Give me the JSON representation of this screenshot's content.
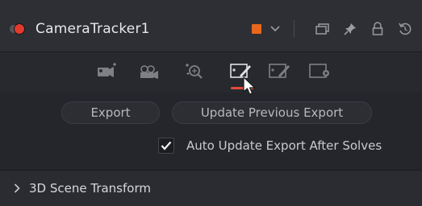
{
  "node": {
    "title": "CameraTracker1",
    "color": "#e8671d",
    "status_color": "#e23a2e"
  },
  "title_icons": [
    "chevron-down-icon",
    "version-icon",
    "pin-icon",
    "lock-icon",
    "reset-icon"
  ],
  "toolbar": {
    "tools": [
      {
        "name": "track-icon"
      },
      {
        "name": "camera-icon"
      },
      {
        "name": "solve-icon"
      },
      {
        "name": "export-icon",
        "active": true
      },
      {
        "name": "refine-icon"
      },
      {
        "name": "options-icon"
      }
    ],
    "active_color": "#e24a3a"
  },
  "buttons": {
    "export_label": "Export",
    "update_label": "Update Previous Export"
  },
  "auto_update": {
    "checked": true,
    "label": "Auto Update Export After Solves"
  },
  "section": {
    "label": "3D Scene Transform",
    "expanded": false
  }
}
